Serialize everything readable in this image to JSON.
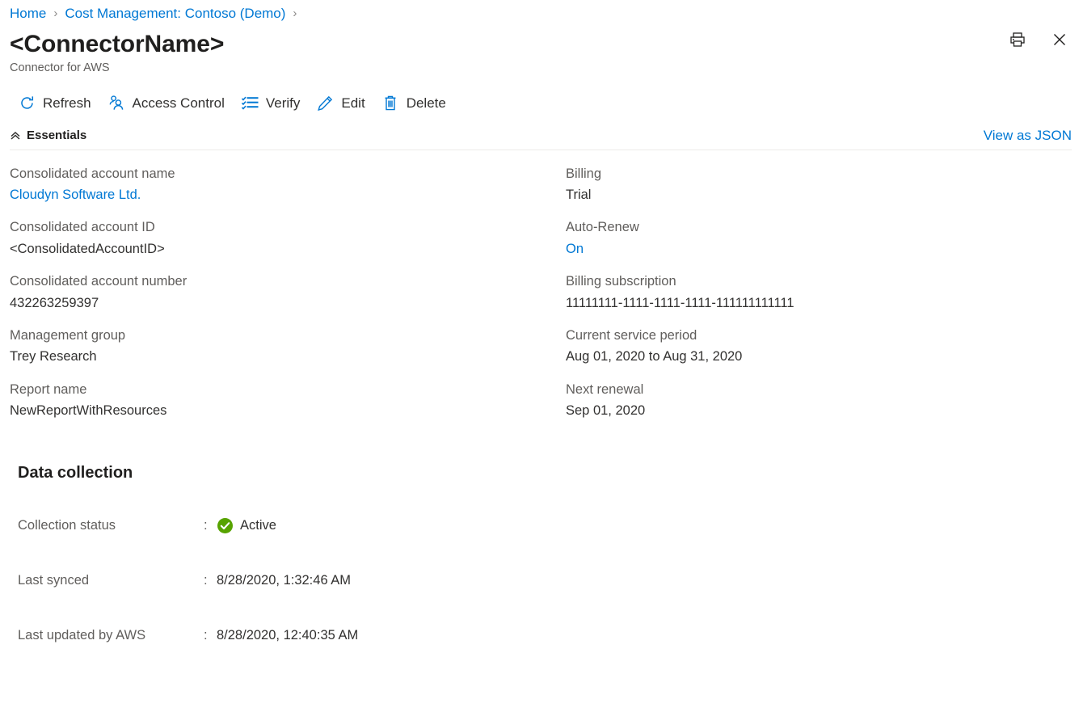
{
  "breadcrumb": {
    "items": [
      {
        "label": "Home"
      },
      {
        "label": "Cost Management: Contoso (Demo)"
      }
    ],
    "separator": "›"
  },
  "header": {
    "title": "<ConnectorName>",
    "subtitle": "Connector for AWS"
  },
  "window_actions": [
    {
      "name": "print",
      "icon": "printer-icon"
    },
    {
      "name": "close",
      "icon": "close-icon"
    }
  ],
  "toolbar": {
    "refresh_label": "Refresh",
    "access_control_label": "Access Control",
    "verify_label": "Verify",
    "edit_label": "Edit",
    "delete_label": "Delete"
  },
  "essentials": {
    "header_label": "Essentials",
    "view_json_label": "View as JSON",
    "left_column": [
      {
        "label": "Consolidated account name",
        "value": "Cloudyn Software Ltd.",
        "is_link": true
      },
      {
        "label": "Consolidated account ID",
        "value": "<ConsolidatedAccountID>",
        "is_link": false
      },
      {
        "label": "Consolidated account number",
        "value": "432263259397",
        "is_link": false
      },
      {
        "label": "Management group",
        "value": "Trey Research",
        "is_link": false
      },
      {
        "label": "Report name",
        "value": "NewReportWithResources",
        "is_link": false
      }
    ],
    "right_column": [
      {
        "label": "Billing",
        "value": "Trial",
        "is_link": false
      },
      {
        "label": "Auto-Renew",
        "value": "On",
        "is_link": true
      },
      {
        "label": "Billing subscription",
        "value": "11111111-1111-1111-1111-111111111111",
        "is_link": false
      },
      {
        "label": "Current service period",
        "value": "Aug 01, 2020 to Aug 31, 2020",
        "is_link": false
      },
      {
        "label": "Next renewal",
        "value": "Sep 01, 2020",
        "is_link": false
      }
    ]
  },
  "data_collection": {
    "title": "Data collection",
    "colon": ":",
    "rows": [
      {
        "label": "Collection status",
        "value": "Active",
        "status_icon": "success-check-icon"
      },
      {
        "label": "Last synced",
        "value": "8/28/2020, 1:32:46 AM",
        "status_icon": null
      },
      {
        "label": "Last updated by AWS",
        "value": "8/28/2020, 12:40:35 AM",
        "status_icon": null
      }
    ]
  },
  "colors": {
    "accent_blue": "#0078d4",
    "status_green": "#57a300",
    "label_gray": "#605e5c",
    "text_dark": "#323130",
    "divider": "#edebe9"
  }
}
